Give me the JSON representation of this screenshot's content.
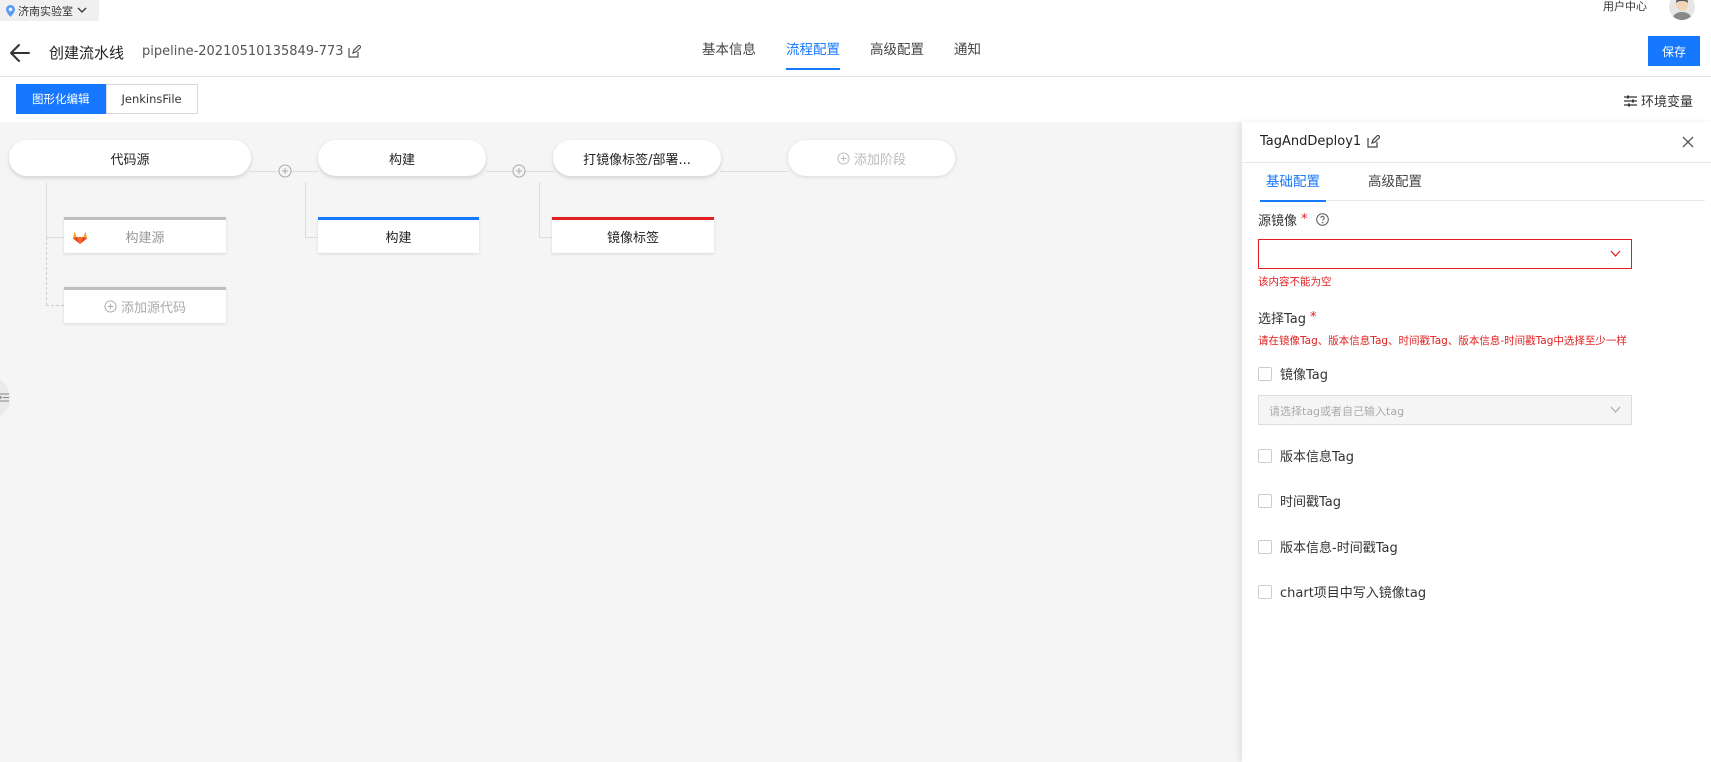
{
  "topbar": {
    "location": "济南实验室",
    "user_center": "用户中心"
  },
  "header": {
    "title": "创建流水线",
    "pipeline_name": "pipeline-20210510135849-773",
    "tabs": [
      {
        "label": "基本信息",
        "active": false
      },
      {
        "label": "流程配置",
        "active": true
      },
      {
        "label": "高级配置",
        "active": false
      },
      {
        "label": "通知",
        "active": false
      }
    ],
    "save_label": "保存"
  },
  "modebar": {
    "graphic_edit": "图形化编辑",
    "jenkinsfile": "JenkinsFile",
    "env_vars": "环境变量"
  },
  "canvas": {
    "stages": [
      {
        "label": "代码源"
      },
      {
        "label": "构建"
      },
      {
        "label": "打镜像标签/部署..."
      }
    ],
    "add_stage": "添加阶段",
    "jobs": {
      "source": "构建源",
      "add_source": "添加源代码",
      "build": "构建",
      "tag": "镜像标签"
    }
  },
  "drawer": {
    "title": "TagAndDeploy1",
    "tabs": [
      {
        "label": "基础配置",
        "active": true
      },
      {
        "label": "高级配置",
        "active": false
      }
    ],
    "source_image_label": "源镜像",
    "required_mark": "*",
    "source_image_error": "该内容不能为空",
    "select_tag_label": "选择Tag",
    "select_tag_hint": "请在镜像Tag、版本信息Tag、时间戳Tag、版本信息-时间戳Tag中选择至少一样",
    "image_tag_label": "镜像Tag",
    "image_tag_placeholder": "请选择tag或者自己输入tag",
    "version_tag_label": "版本信息Tag",
    "timestamp_tag_label": "时间戳Tag",
    "version_timestamp_tag_label": "版本信息-时间戳Tag",
    "chart_tag_label": "chart项目中写入镜像tag"
  },
  "colors": {
    "primary": "#1677ff",
    "error": "#e02020",
    "canvas_bg": "#f5f5f5"
  }
}
